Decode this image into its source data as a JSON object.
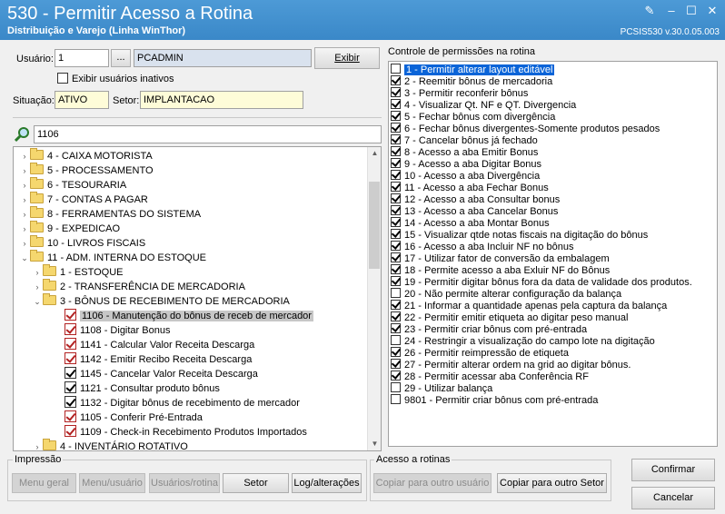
{
  "window": {
    "title": "530 - Permitir Acesso a Rotina",
    "subtitle": "Distribuição e Varejo (Linha WinThor)",
    "version": "PCSIS530  v.30.0.05.003"
  },
  "user": {
    "label": "Usuário:",
    "code": "1",
    "lookup_btn": "...",
    "name": "PCADMIN",
    "exibir_btn": "Exibir",
    "inactive_label": "Exibir usuários inativos",
    "situacao_label": "Situação:",
    "situacao_value": "ATIVO",
    "setor_label": "Setor:",
    "setor_value": "IMPLANTACAO"
  },
  "search": {
    "value": "1106"
  },
  "tree": {
    "folders": [
      "4 - CAIXA MOTORISTA",
      "5 - PROCESSAMENTO",
      "6 - TESOURARIA",
      "7 - CONTAS A PAGAR",
      "8 - FERRAMENTAS DO SISTEMA",
      "9 - EXPEDICAO",
      "10 - LIVROS FISCAIS",
      "11 - ADM. INTERNA DO ESTOQUE"
    ],
    "subfolders": [
      "1 - ESTOQUE",
      "2 - TRANSFERÊNCIA DE MERCADORIA",
      "3 - BÔNUS DE RECEBIMENTO DE MERCADORIA"
    ],
    "routines": [
      {
        "label": "1106 - Manutenção do bônus de receb de mercador",
        "checked": true,
        "red": true,
        "selected": true
      },
      {
        "label": "1108 - Digitar Bonus",
        "checked": true,
        "red": true,
        "selected": false
      },
      {
        "label": "1141 - Calcular  Valor Receita Descarga",
        "checked": true,
        "red": true,
        "selected": false
      },
      {
        "label": "1142 - Emitir Recibo Receita Descarga",
        "checked": true,
        "red": true,
        "selected": false
      },
      {
        "label": "1145 - Cancelar  Valor Receita Descarga",
        "checked": true,
        "red": false,
        "selected": false
      },
      {
        "label": "1121 - Consultar produto bônus",
        "checked": true,
        "red": false,
        "selected": false
      },
      {
        "label": "1132 - Digitar bônus de recebimento de mercador",
        "checked": true,
        "red": false,
        "selected": false
      },
      {
        "label": "1105 - Conferir Pré-Entrada",
        "checked": true,
        "red": true,
        "selected": false
      },
      {
        "label": "1109 - Check-in Recebimento Produtos Importados",
        "checked": true,
        "red": true,
        "selected": false
      }
    ],
    "last_folder": "4 - INVENTÁRIO ROTATIVO"
  },
  "permissions": {
    "title": "Controle de permissões na rotina",
    "items": [
      {
        "label": "1 - Permitir alterar layout editável",
        "checked": false
      },
      {
        "label": "2 - Reemitir bônus de mercadoria",
        "checked": true
      },
      {
        "label": "3 - Permitir reconferir bônus",
        "checked": true
      },
      {
        "label": "4 - Visualizar Qt. NF e QT. Divergencia",
        "checked": true
      },
      {
        "label": "5 - Fechar bônus com divergência",
        "checked": true
      },
      {
        "label": "6 - Fechar bônus divergentes-Somente produtos pesados",
        "checked": true
      },
      {
        "label": "7 - Cancelar bônus já fechado",
        "checked": true
      },
      {
        "label": "8 - Acesso a aba Emitir Bonus",
        "checked": true
      },
      {
        "label": "9 - Acesso a aba Digitar Bonus",
        "checked": true
      },
      {
        "label": "10 - Acesso a aba Divergência",
        "checked": true
      },
      {
        "label": "11 - Acesso a aba Fechar Bonus",
        "checked": true
      },
      {
        "label": "12 - Acesso a aba Consultar bonus",
        "checked": true
      },
      {
        "label": "13 - Acesso a aba Cancelar Bonus",
        "checked": true
      },
      {
        "label": "14 - Acesso a aba Montar Bonus",
        "checked": true
      },
      {
        "label": "15 - Visualizar qtde notas fiscais na digitação do bônus",
        "checked": true
      },
      {
        "label": "16 - Acesso a aba Incluir NF no bônus",
        "checked": true
      },
      {
        "label": "17 - Utilizar fator de conversão da embalagem",
        "checked": true
      },
      {
        "label": "18 - Permite acesso a aba Exluir NF do Bônus",
        "checked": true
      },
      {
        "label": "19 - Permitir digitar bônus fora da data de validade dos produtos.",
        "checked": true
      },
      {
        "label": "20 - Não permite alterar configuração da balança",
        "checked": false
      },
      {
        "label": "21 - Informar a quantidade apenas pela captura da balança",
        "checked": true
      },
      {
        "label": "22 - Permitir emitir etiqueta ao digitar peso manual",
        "checked": true
      },
      {
        "label": "23 - Permitir criar bônus com pré-entrada",
        "checked": true
      },
      {
        "label": "24 - Restringir a visualização do campo lote na digitação",
        "checked": false
      },
      {
        "label": "26 - Permitir reimpressão de etiqueta",
        "checked": true
      },
      {
        "label": "27 - Permitir alterar ordem na grid ao digitar bônus.",
        "checked": true
      },
      {
        "label": "28 - Permitir acessar aba Conferência RF",
        "checked": true
      },
      {
        "label": "29 - Utilizar balança",
        "checked": false
      },
      {
        "label": "9801 - Permitir criar bônus com pré-entrada",
        "checked": false
      }
    ]
  },
  "impressao": {
    "title": "Impressão",
    "menu_geral": "Menu geral",
    "menu_usuario": "Menu/usuário",
    "usuarios_rotina": "Usuários/rotina",
    "setor": "Setor",
    "log": "Log/alterações"
  },
  "acesso": {
    "title": "Acesso a rotinas",
    "copiar_usuario": "Copiar para outro usuário",
    "copiar_setor": "Copiar para outro Setor"
  },
  "actions": {
    "confirmar": "Confirmar",
    "cancelar": "Cancelar"
  }
}
